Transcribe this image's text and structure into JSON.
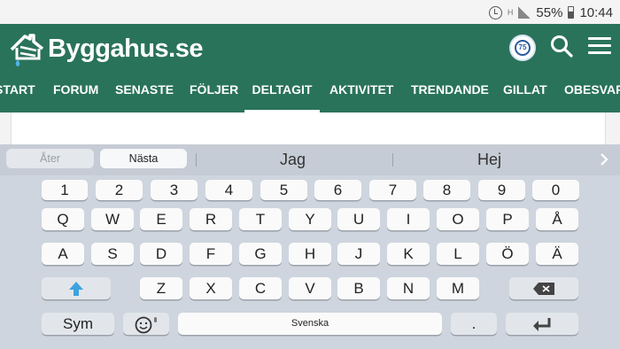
{
  "status_bar": {
    "battery_percent": "55%",
    "time": "10:44",
    "network_letter": "H"
  },
  "header": {
    "site_name": "Byggahus.se",
    "badge_text": "75",
    "icons": [
      "house-logo-icon",
      "anniversary-badge-icon",
      "search-icon",
      "hamburger-menu-icon"
    ],
    "colors": {
      "header_bg": "#2a735b",
      "keyboard_bg": "#ced5de"
    },
    "nav": [
      {
        "label": "START",
        "active": false
      },
      {
        "label": "FORUM",
        "active": false
      },
      {
        "label": "SENASTE",
        "active": false
      },
      {
        "label": "FÖLJER",
        "active": false
      },
      {
        "label": "DELTAGIT",
        "active": true
      },
      {
        "label": "AKTIVITET",
        "active": false
      },
      {
        "label": "TRENDANDE",
        "active": false
      },
      {
        "label": "GILLAT",
        "active": false
      },
      {
        "label": "OBESVARADE",
        "active": false
      }
    ]
  },
  "keyboard": {
    "back_label": "Åter",
    "next_label": "Nästa",
    "suggestions": [
      "Jag",
      "Hej"
    ],
    "rows": {
      "numbers": [
        "1",
        "2",
        "3",
        "4",
        "5",
        "6",
        "7",
        "8",
        "9",
        "0"
      ],
      "row1": [
        "Q",
        "W",
        "E",
        "R",
        "T",
        "Y",
        "U",
        "I",
        "O",
        "P",
        "Å"
      ],
      "row2": [
        "A",
        "S",
        "D",
        "F",
        "G",
        "H",
        "J",
        "K",
        "L",
        "Ö",
        "Ä"
      ],
      "row3": [
        "Z",
        "X",
        "C",
        "V",
        "B",
        "N",
        "M"
      ]
    },
    "sym_label": "Sym",
    "space_label": "Svenska",
    "period_label": "."
  }
}
